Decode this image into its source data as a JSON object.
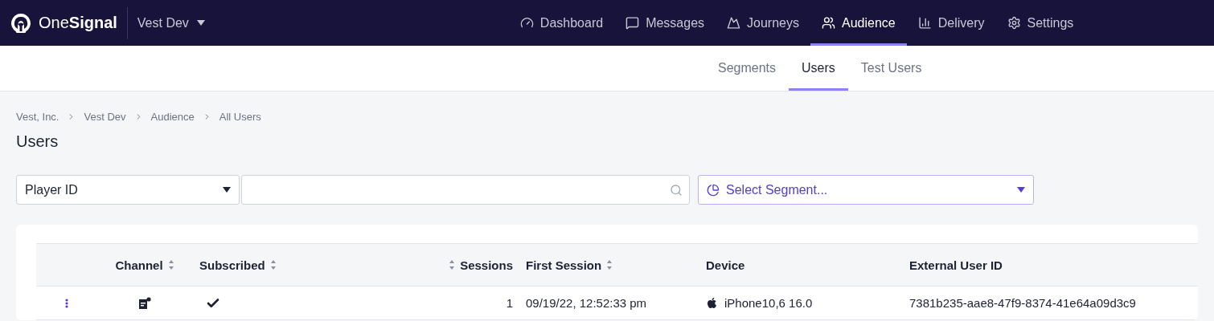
{
  "brand": {
    "name_light": "One",
    "name_bold": "Signal"
  },
  "app_switcher": {
    "label": "Vest Dev"
  },
  "nav": [
    {
      "label": "Dashboard",
      "selected": false
    },
    {
      "label": "Messages",
      "selected": false
    },
    {
      "label": "Journeys",
      "selected": false
    },
    {
      "label": "Audience",
      "selected": true
    },
    {
      "label": "Delivery",
      "selected": false
    },
    {
      "label": "Settings",
      "selected": false
    }
  ],
  "subtabs": [
    {
      "label": "Segments",
      "selected": false
    },
    {
      "label": "Users",
      "selected": true
    },
    {
      "label": "Test Users",
      "selected": false
    }
  ],
  "breadcrumbs": [
    "Vest, Inc.",
    "Vest Dev",
    "Audience",
    "All Users"
  ],
  "title": "Users",
  "filters": {
    "field": "Player ID",
    "segment": "Select Segment..."
  },
  "table": {
    "columns": [
      {
        "sortable": false
      },
      {
        "label": "Channel",
        "sortable": true
      },
      {
        "label": "Subscribed",
        "sortable": true
      },
      {
        "label": "Sessions",
        "sortable": true
      },
      {
        "label": "First Session",
        "sortable": true
      },
      {
        "label": "Device",
        "sortable": false
      },
      {
        "label": "External User ID",
        "sortable": false
      }
    ],
    "rows": [
      {
        "subscribed": true,
        "sessions": "1",
        "first_session": "09/19/22, 12:52:33 pm",
        "device": "iPhone10,6 16.0",
        "external_user_id": "7381b235-aae8-47f9-8374-41e64a09d3c9"
      }
    ]
  }
}
